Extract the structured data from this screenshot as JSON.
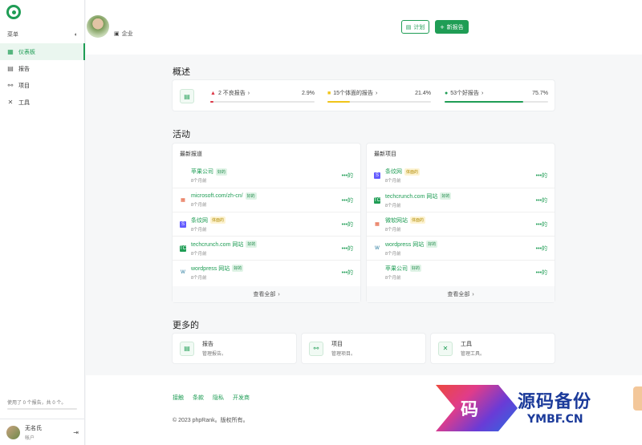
{
  "sidebar": {
    "menu_label": "菜单",
    "items": [
      {
        "label": "仪表板",
        "icon": "dashboard-icon",
        "active": true
      },
      {
        "label": "报告",
        "icon": "report-icon",
        "active": false
      },
      {
        "label": "项目",
        "icon": "project-icon",
        "active": false
      },
      {
        "label": "工具",
        "icon": "tools-icon",
        "active": false
      }
    ],
    "usage_text": "使用了 0 个报告，共 0 个。",
    "usage_fraction": 0,
    "user": {
      "name": "无名氏",
      "role": "帐户"
    }
  },
  "header": {
    "company_label": "企业",
    "plan_button": "计划",
    "new_report_button": "新报告"
  },
  "overview": {
    "title": "概述",
    "stats": [
      {
        "label": "2 不良报告",
        "percent_text": "2.9%",
        "percent": 2.9,
        "color": "#dc3545"
      },
      {
        "label": "15个体面的报告",
        "percent_text": "21.4%",
        "percent": 21.4,
        "color": "#f0c419"
      },
      {
        "label": "53个好报告",
        "percent_text": "75.7%",
        "percent": 75.7,
        "color": "#1f9d55"
      }
    ]
  },
  "activity": {
    "title": "活动",
    "view_all": "查看全部",
    "latest_reports": {
      "title": "最新报道",
      "items": [
        {
          "name": "苹果公司",
          "badge": "好的",
          "badge_type": "good",
          "time": "8个月前",
          "icon": "apple-icon"
        },
        {
          "name": "microsoft.com/zh-cn/",
          "badge": "好的",
          "badge_type": "good",
          "time": "8个月前",
          "icon": "microsoft-icon"
        },
        {
          "name": "条纹网",
          "badge": "体面的",
          "badge_type": "med",
          "time": "8个月前",
          "icon": "stripe-icon"
        },
        {
          "name": "techcrunch.com 网站",
          "badge": "好的",
          "badge_type": "good",
          "time": "8个月前",
          "icon": "techcrunch-icon"
        },
        {
          "name": "wordpress 网站",
          "badge": "好的",
          "badge_type": "good",
          "time": "8个月前",
          "icon": "wordpress-icon"
        }
      ]
    },
    "latest_projects": {
      "title": "最新项目",
      "items": [
        {
          "name": "条纹网",
          "badge": "体面的",
          "badge_type": "med",
          "time": "8个月前",
          "icon": "stripe-icon"
        },
        {
          "name": "techcrunch.com 网站",
          "badge": "好的",
          "badge_type": "good",
          "time": "8个月前",
          "icon": "techcrunch-icon"
        },
        {
          "name": "微软网站",
          "badge": "体面的",
          "badge_type": "med",
          "time": "8个月前",
          "icon": "microsoft-icon"
        },
        {
          "name": "wordpress 网站",
          "badge": "好的",
          "badge_type": "good",
          "time": "8个月前",
          "icon": "wordpress-icon"
        },
        {
          "name": "苹果公司",
          "badge": "好的",
          "badge_type": "good",
          "time": "8个月前",
          "icon": "apple-icon"
        }
      ]
    },
    "more_button": "•••的"
  },
  "more": {
    "title": "更多的",
    "cards": [
      {
        "title": "报告",
        "desc": "管理报告。",
        "icon": "report-icon"
      },
      {
        "title": "项目",
        "desc": "管理项目。",
        "icon": "project-icon"
      },
      {
        "title": "工具",
        "desc": "管理工具。",
        "icon": "tools-icon"
      }
    ]
  },
  "footer": {
    "links": [
      "接触",
      "条款",
      "隐私",
      "开发商"
    ],
    "copyright": "© 2023 phpRank。版权所有。"
  },
  "watermark": {
    "glyph": "码",
    "cn": "源码备份",
    "en": "YMBF.CN"
  },
  "colors": {
    "accent": "#1f9d55",
    "bad": "#dc3545",
    "decent": "#f0c419"
  }
}
